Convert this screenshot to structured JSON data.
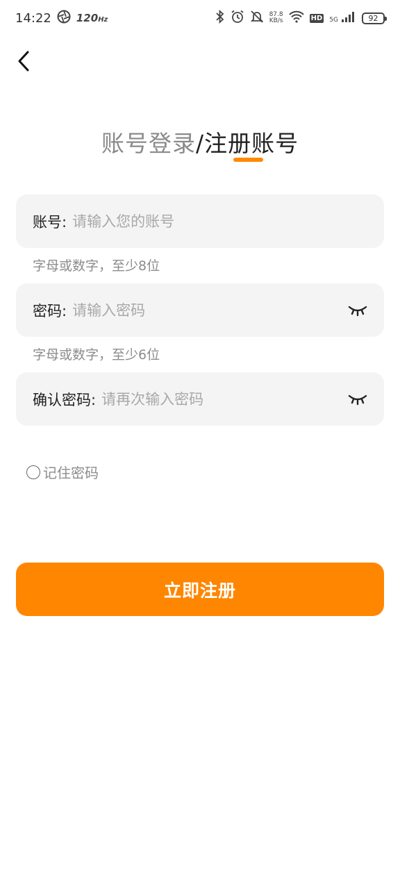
{
  "status_bar": {
    "time": "14:22",
    "refresh_rate": "120",
    "refresh_unit": "Hz",
    "net_speed": "87.8",
    "net_unit": "KB/s",
    "hd": "HD",
    "network": "5G",
    "battery": "92"
  },
  "tabs": {
    "login": "账号登录",
    "separator": "/",
    "register": "注册账号",
    "active": "register",
    "accent_color": "#ff8a00"
  },
  "form": {
    "account": {
      "label": "账号:",
      "placeholder": "请输入您的账号",
      "value": "",
      "hint": "字母或数字，至少8位"
    },
    "password": {
      "label": "密码:",
      "placeholder": "请输入密码",
      "value": "",
      "hint": "字母或数字，至少6位",
      "toggle_icon": "eye-closed-icon"
    },
    "confirm_password": {
      "label": "确认密码:",
      "placeholder": "请再次输入密码",
      "value": "",
      "toggle_icon": "eye-closed-icon"
    },
    "remember": {
      "label": "记住密码",
      "checked": false
    },
    "submit_label": "立即注册",
    "submit_color": "#ff8600"
  }
}
